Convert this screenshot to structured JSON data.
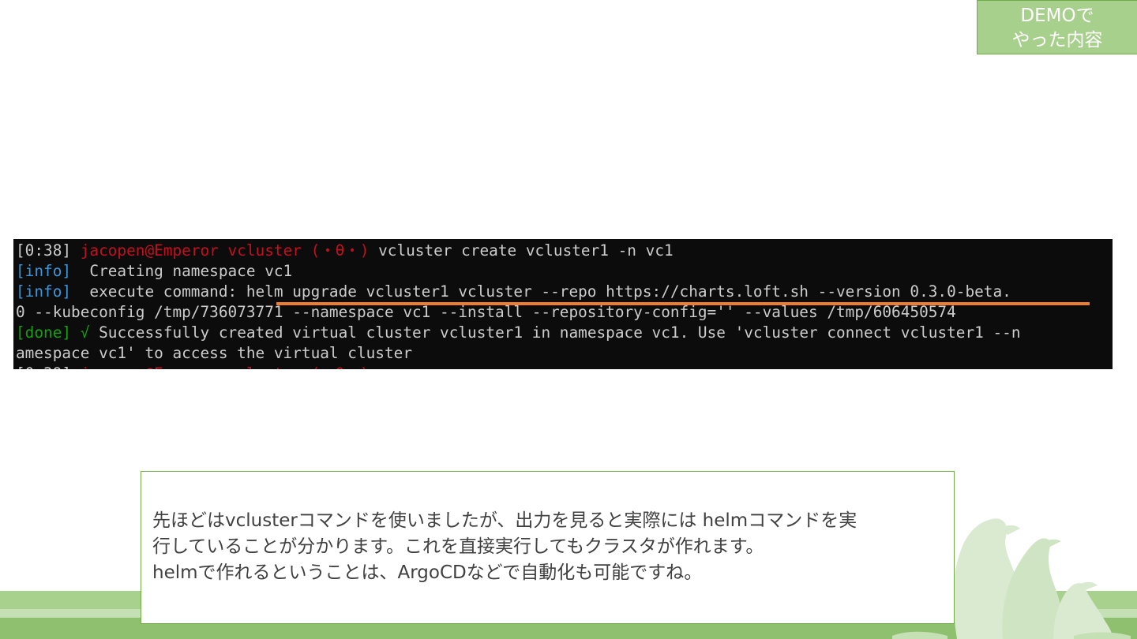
{
  "tag": {
    "line1": "DEMOで",
    "line2": "やった内容"
  },
  "terminal": {
    "line1": {
      "time": "[0:38]",
      "prompt": "jacopen@Emperor vcluster (・θ・)",
      "command": "vcluster create vcluster1 -n vc1"
    },
    "line2": {
      "tag": "[info]",
      "text": "  Creating namespace vc1"
    },
    "line3": {
      "tag": "[info]",
      "text": "  execute command: helm upgrade vcluster1 vcluster --repo https://charts.loft.sh --version 0.3.0-beta."
    },
    "line4": {
      "text": "0 --kubeconfig /tmp/736073771 --namespace vc1 --install --repository-config='' --values /tmp/606450574"
    },
    "line5": {
      "tag": "[done] √",
      "text": "Successfully created virtual cluster vcluster1 in namespace vc1. Use 'vcluster connect vcluster1 --n"
    },
    "line6": {
      "text": "amespace vc1' to access the virtual cluster"
    },
    "highlight_color": "#ed7d31"
  },
  "description": {
    "line1": "先ほどはvclusterコマンドを使いましたが、出力を見ると実際には helmコマンドを実",
    "line2": "行していることが分かります。これを直接実行してもクラスタが作れます。",
    "line3": "helmで作れるということは、ArgoCDなどで自動化も可能ですね。"
  },
  "colors": {
    "accent_green": "#70ad47",
    "light_green": "#a9d18e",
    "terminal_bg": "#0c0c0c"
  },
  "decoration": {
    "icon": "penguin-silhouette-icon"
  }
}
